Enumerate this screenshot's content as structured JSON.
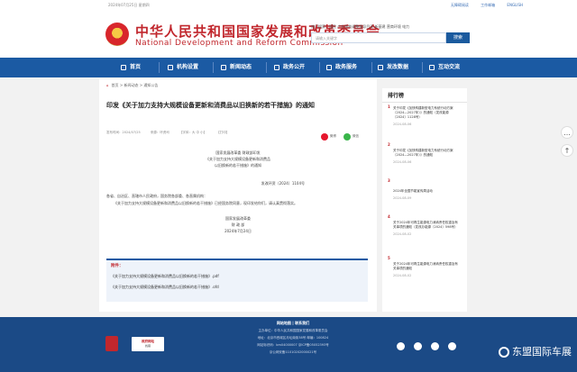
{
  "topbar": {
    "date": "2024年07月25日 星期四",
    "accessible": "无障碍阅读",
    "mobile": "工作邮箱",
    "english": "ENGLISH"
  },
  "header": {
    "title_cn": "中华人民共和国国家发展和改革委员会",
    "title_en": "National Development and Reform Commission",
    "hotwords": "热门搜索：国民 产业结构调整指导目录 新基建 营商环境 电力",
    "search_placeholder": "请输入关键字",
    "search_button": "搜索"
  },
  "nav": [
    {
      "label": "首页"
    },
    {
      "label": "机构设置"
    },
    {
      "label": "新闻动态"
    },
    {
      "label": "政务公开"
    },
    {
      "label": "政务服务"
    },
    {
      "label": "发改数据"
    },
    {
      "label": "互动交流"
    }
  ],
  "breadcrumb": {
    "home": "首页",
    "path": "> 新闻动态 > 通知公告"
  },
  "article": {
    "title": "印发《关于加力支持大规模设备更新和消费品以旧换新的若干措施》的通知",
    "meta_date": "发布时间：2024/07/25",
    "meta_source": "来源：环资司",
    "meta_font": "【字体：大 中 小】",
    "meta_print": "【打印】",
    "share_weibo": "微博",
    "share_wechat": "微信",
    "body": [
      "国家发展改革委 财政部印发",
      "《关于加力支持大规模设备更新和消费品",
      "以旧换新的若干措施》的通知",
      "发改环资〔2024〕1104号"
    ],
    "greeting": "各省、自治区、直辖市人民政府，国务院各部委、各直属机构：",
    "para": "《关于加力支持大规模设备更新和消费品以旧换新的若干措施》已经国务院同意，现印发给你们，请认真贯彻落实。",
    "sign1": "国家发展改革委",
    "sign2": "财 政 部",
    "sign_date": "2024年7月24日",
    "attach_header": "附件：",
    "attachments": [
      "《关于加力支持大规模设备更新和消费品以旧换新的若干措施》.pdf",
      "《关于加力支持大规模设备更新和消费品以旧换新的若干措施》.ofd"
    ]
  },
  "sidebar": {
    "title": "排行榜",
    "items": [
      {
        "num": "1",
        "text": "关于印发《加快构建新型电力系统行动方案（2024—2027年）》的通知（发改能源〔2024〕1128号）",
        "date": "2024-08-06"
      },
      {
        "num": "2",
        "text": "关于印发《加快构建新型电力系统行动方案（2024—2027年）》的通知",
        "date": "2024-08-06"
      },
      {
        "num": "3",
        "text": "2024年全国节能宣传周活动",
        "date": "2024-08-09"
      },
      {
        "num": "4",
        "text": "关于2024年可再生能源电力消纳责任权重及有关事项的通知（发改办能源〔2024〕598号）",
        "date": "2024-08-02"
      },
      {
        "num": "5",
        "text": "关于2024年可再生能源电力消纳责任权重及有关事项的通知",
        "date": "2024-08-02"
      }
    ]
  },
  "footer": {
    "links": "网站地图 | 联系我们",
    "line1": "主办单位：中华人民共和国国家发展和改革委员会",
    "line2": "地址：北京市西城区月坛南街38号 邮编：100824",
    "line3": "网站标识码：bm04000007 京ICP备05052393号",
    "line4": "京公网安备11010202000021号",
    "badge2_title": "政府网站",
    "badge2_sub": "找错"
  },
  "watermark": "东盟国际车展",
  "colors": {
    "brand_red": "#c1272d",
    "nav_blue": "#1b5aa3",
    "footer_blue": "#1b4a86"
  }
}
